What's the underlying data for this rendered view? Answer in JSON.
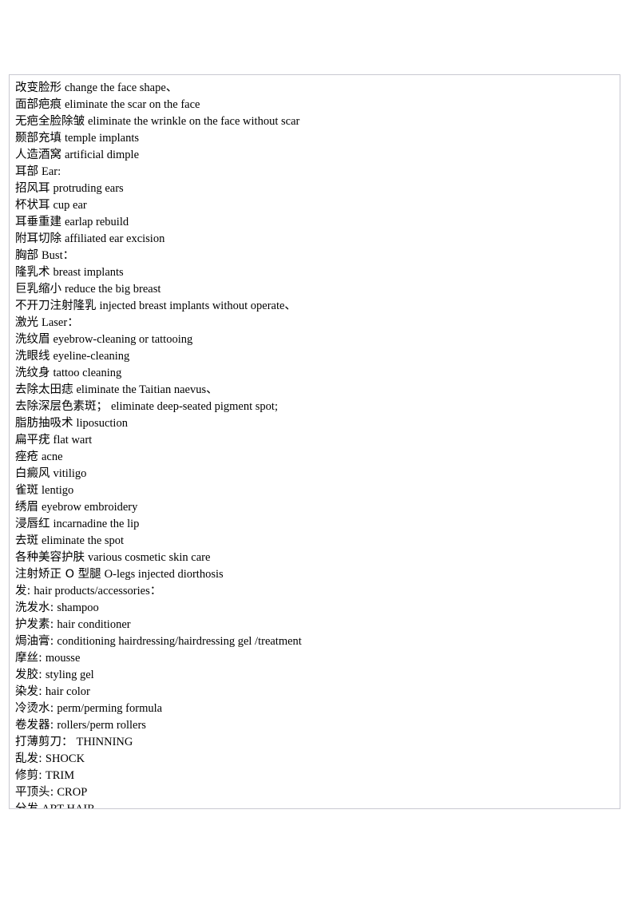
{
  "document": {
    "background_color": "#ffffff",
    "text_color": "#000000",
    "border_color": "#c9c9d1",
    "entries": [
      {
        "zh": "改变脸形",
        "en": "change the face shape、"
      },
      {
        "zh": "面部疤痕",
        "en": "eliminate the scar on the face"
      },
      {
        "zh": "无疤全脸除皱",
        "en": "eliminate the wrinkle on the face without scar"
      },
      {
        "zh": "颞部充填",
        "en": "temple implants"
      },
      {
        "zh": "人造酒窝",
        "en": "artificial dimple"
      },
      {
        "zh": "耳部",
        "en": "Ear:"
      },
      {
        "zh": "招风耳",
        "en": "protruding ears"
      },
      {
        "zh": "杯状耳",
        "en": "cup ear"
      },
      {
        "zh": "耳垂重建",
        "en": "earlap rebuild"
      },
      {
        "zh": "附耳切除",
        "en": "affiliated ear excision"
      },
      {
        "zh": "胸部",
        "en": "Bust："
      },
      {
        "zh": "隆乳术",
        "en": "breast implants"
      },
      {
        "zh": "巨乳缩小",
        "en": "reduce the big breast"
      },
      {
        "zh": "不开刀注射隆乳",
        "en": "injected breast implants without operate、"
      },
      {
        "zh": "激光",
        "en": "Laser："
      },
      {
        "zh": "洗纹眉",
        "en": "eyebrow-cleaning or tattooing"
      },
      {
        "zh": "洗眼线",
        "en": "eyeline-cleaning"
      },
      {
        "zh": "洗纹身",
        "en": "tattoo cleaning"
      },
      {
        "zh": "去除太田痣",
        "en": "eliminate the Taitian naevus、"
      },
      {
        "zh": "去除深层色素斑；",
        "en": "eliminate deep-seated pigment spot;"
      },
      {
        "zh": "脂肪抽吸术",
        "en": "liposuction"
      },
      {
        "zh": "扁平疣",
        "en": "flat wart"
      },
      {
        "zh": "痤疮",
        "en": "acne"
      },
      {
        "zh": "白癜风",
        "en": "vitiligo"
      },
      {
        "zh": "雀斑",
        "en": "lentigo"
      },
      {
        "zh": "绣眉",
        "en": "eyebrow embroidery"
      },
      {
        "zh": "浸唇红",
        "en": "incarnadine the lip"
      },
      {
        "zh": "去斑",
        "en": "eliminate the spot"
      },
      {
        "zh": "各种美容护肤",
        "en": "various cosmetic skin care"
      },
      {
        "zh": "注射矫正 O 型腿",
        "en": "O-legs injected diorthosis"
      },
      {
        "zh": "发:",
        "en": "hair products/accessories："
      },
      {
        "zh": "洗发水:",
        "en": "shampoo"
      },
      {
        "zh": "护发素:",
        "en": "hair conditioner"
      },
      {
        "zh": "焗油膏:",
        "en": "conditioning hairdressing/hairdressing gel /treatment"
      },
      {
        "zh": "摩丝:",
        "en": "mousse"
      },
      {
        "zh": "发胶:",
        "en": "styling gel"
      },
      {
        "zh": "染发:",
        "en": "hair color"
      },
      {
        "zh": "冷烫水:",
        "en": "perm/perming formula"
      },
      {
        "zh": "卷发器:",
        "en": "rollers/perm rollers"
      },
      {
        "zh": "打薄剪刀：",
        "en": "THINNING"
      },
      {
        "zh": "乱发:",
        "en": "SHOCK"
      },
      {
        "zh": "修剪:",
        "en": "TRIM"
      },
      {
        "zh": "平顶头:",
        "en": "CROP"
      },
      {
        "zh": "分发",
        "en": "ART HAIR"
      }
    ]
  }
}
